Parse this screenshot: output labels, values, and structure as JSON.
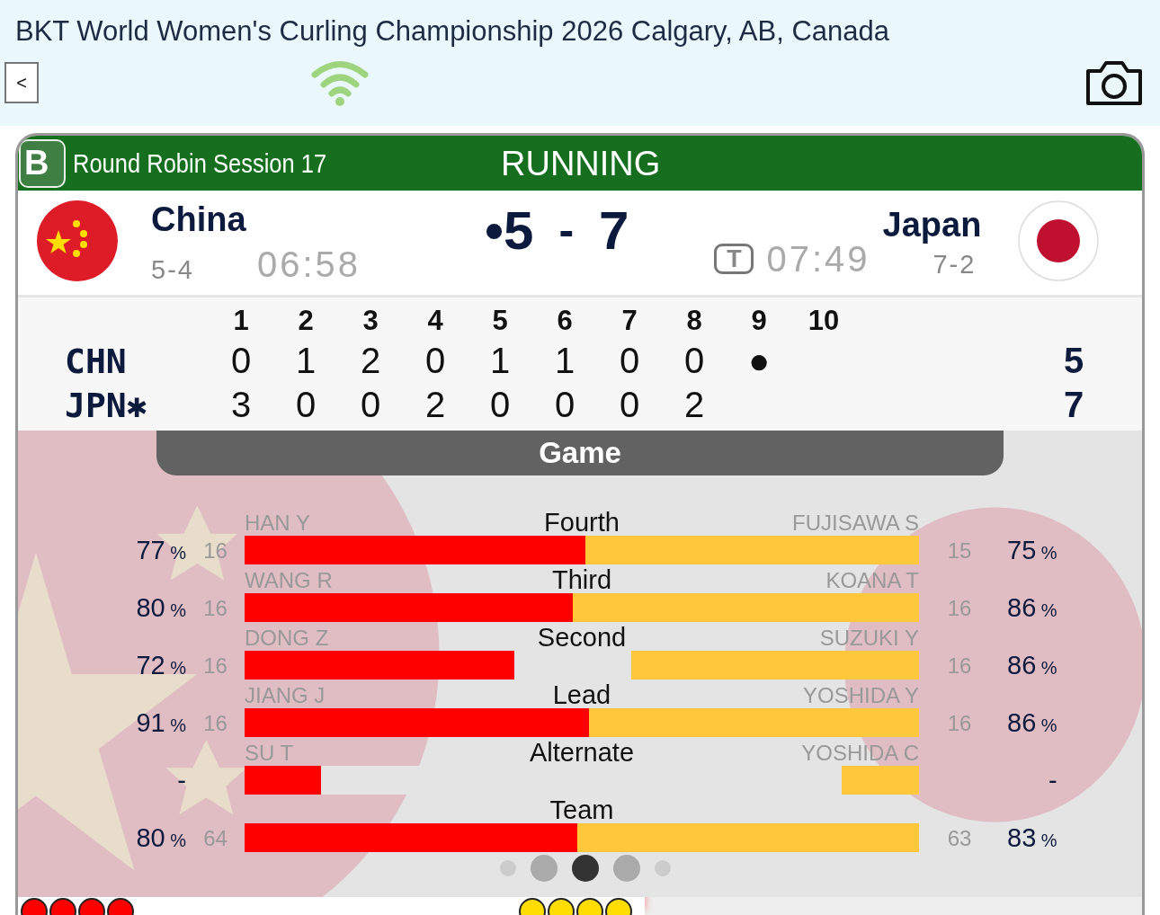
{
  "header": {
    "title": "BKT World Women's Curling Championship 2026 Calgary, AB, Canada",
    "back_label": "<"
  },
  "game": {
    "sheet": "B",
    "session": "Round Robin Session 17",
    "status": "RUNNING",
    "home": {
      "name": "China",
      "record": "5-4",
      "clock": "06:58",
      "score": "•5"
    },
    "separator": "-",
    "away": {
      "name": "Japan",
      "record": "7-2",
      "clock": "07:49",
      "timeout_badge": "T",
      "score": "7"
    }
  },
  "linescore": {
    "ends": [
      "1",
      "2",
      "3",
      "4",
      "5",
      "6",
      "7",
      "8",
      "9",
      "10"
    ],
    "rows": [
      {
        "team": "CHN",
        "scores": [
          "0",
          "1",
          "2",
          "0",
          "1",
          "1",
          "0",
          "0",
          "●"
        ],
        "total": "5"
      },
      {
        "team": "JPN✱",
        "scores": [
          "3",
          "0",
          "0",
          "2",
          "0",
          "0",
          "0",
          "2"
        ],
        "total": "7"
      }
    ]
  },
  "stats": {
    "tab": "Game",
    "rows": [
      {
        "position": "Fourth",
        "home": {
          "name": "HAN Y",
          "pct": "77",
          "sign": "%",
          "shots": "16",
          "level": 0.505
        },
        "away": {
          "name": "FUJISAWA S",
          "pct": "75",
          "sign": "%",
          "shots": "15",
          "level": 0.495
        }
      },
      {
        "position": "Third",
        "home": {
          "name": "WANG R",
          "pct": "80",
          "sign": "%",
          "shots": "16",
          "level": 0.487
        },
        "away": {
          "name": "KOANA T",
          "pct": "86",
          "sign": "%",
          "shots": "16",
          "level": 0.513
        }
      },
      {
        "position": "Second",
        "home": {
          "name": "DONG Z",
          "pct": "72",
          "sign": "%",
          "shots": "16",
          "level": 0.4
        },
        "away": {
          "name": "SUZUKI Y",
          "pct": "86",
          "sign": "%",
          "shots": "16",
          "level": 0.427
        }
      },
      {
        "position": "Lead",
        "home": {
          "name": "JIANG J",
          "pct": "91",
          "sign": "%",
          "shots": "16",
          "level": 0.511
        },
        "away": {
          "name": "YOSHIDA Y",
          "pct": "86",
          "sign": "%",
          "shots": "16",
          "level": 0.489
        }
      },
      {
        "position": "Alternate",
        "home": {
          "name": "SU T",
          "pct": "-",
          "level": 0.113
        },
        "away": {
          "name": "YOSHIDA C",
          "pct": "-",
          "level": 0.115
        }
      },
      {
        "position": "Team",
        "home": {
          "pct": "80",
          "sign": "%",
          "shots": "64",
          "level": 0.493
        },
        "away": {
          "pct": "83",
          "sign": "%",
          "shots": "63",
          "level": 0.507
        }
      }
    ]
  },
  "pager": [
    {
      "selected": false
    },
    {
      "selected": false
    },
    {
      "selected": true
    },
    {
      "selected": false
    },
    {
      "selected": false
    }
  ],
  "stones": {
    "home": [
      {
        "color": "#ff0000"
      },
      {
        "color": "#ff0000"
      },
      {
        "color": "#ff0000"
      },
      {
        "color": "#ff0000"
      }
    ],
    "away": [
      {
        "color": "#ffdd00"
      },
      {
        "color": "#ffdd00"
      },
      {
        "color": "#ffdd00"
      },
      {
        "color": "#ffdd00"
      }
    ]
  }
}
